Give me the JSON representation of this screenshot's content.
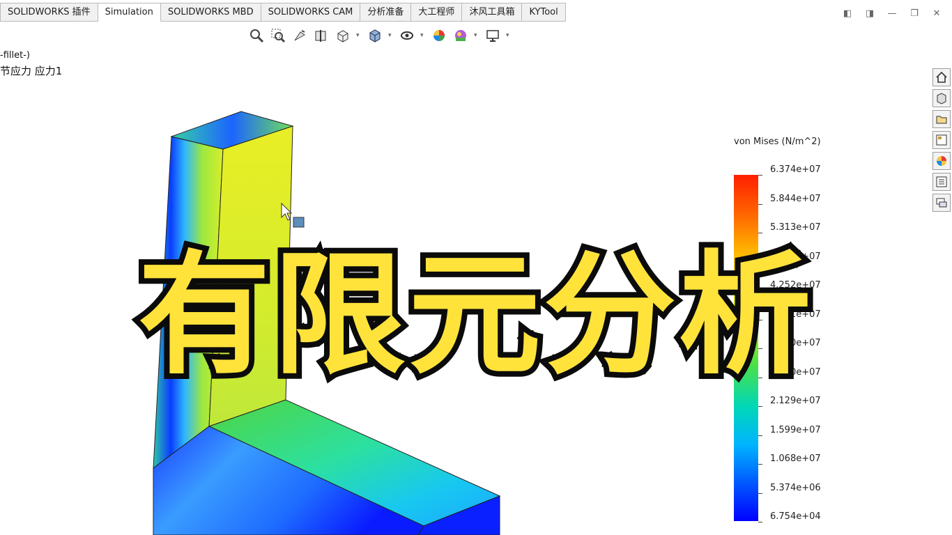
{
  "tabs": [
    {
      "label": "SOLIDWORKS 插件",
      "active": false
    },
    {
      "label": "Simulation",
      "active": true
    },
    {
      "label": "SOLIDWORKS MBD",
      "active": false
    },
    {
      "label": "SOLIDWORKS CAM",
      "active": false
    },
    {
      "label": "分析准备",
      "active": false
    },
    {
      "label": "大工程师",
      "active": false
    },
    {
      "label": "沐风工具箱",
      "active": false
    },
    {
      "label": "KYTool",
      "active": false
    }
  ],
  "study": {
    "line1": "-fillet-)",
    "line2": "节应力 应力1"
  },
  "legend": {
    "title": "von Mises (N/m^2)",
    "labels": [
      "6.374e+07",
      "5.844e+07",
      "5.313e+07",
      "4.782e+07",
      "4.252e+07",
      "3.721e+07",
      "3.190e+07",
      "2.660e+07",
      "2.129e+07",
      "1.599e+07",
      "1.068e+07",
      "5.374e+06",
      "6.754e+04"
    ],
    "colors": {
      "max": "#ff1e00",
      "mid": "#ffee00",
      "low": "#00d7b8",
      "min": "#0000ff"
    }
  },
  "overlay_title": "有限元分析",
  "icons": {
    "hud": [
      "zoom-to-fit-icon",
      "zoom-area-icon",
      "previous-view-icon",
      "section-view-icon",
      "view-orientation-icon",
      "display-style-icon",
      "hide-show-icon",
      "edit-appearance-icon",
      "apply-scene-icon",
      "view-settings-icon"
    ],
    "taskpane": [
      "home-icon",
      "design-library-icon",
      "file-explorer-icon",
      "view-palette-icon",
      "appearances-icon",
      "custom-properties-icon",
      "forum-icon"
    ]
  }
}
